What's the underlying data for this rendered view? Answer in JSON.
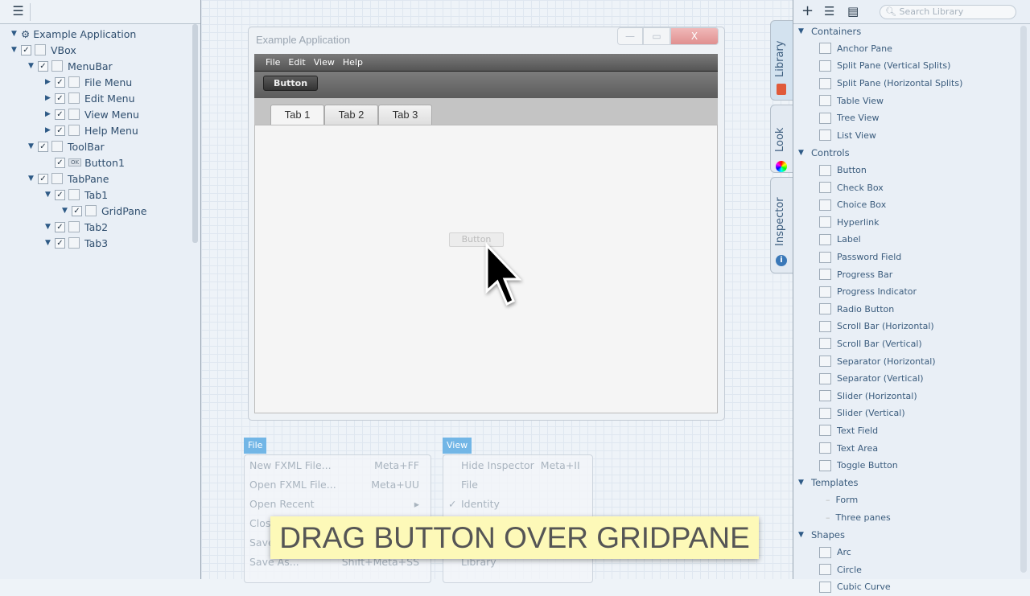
{
  "hierarchy": {
    "nodes": [
      {
        "label": "Example Application",
        "depth": 0,
        "check": false,
        "box": false,
        "expand": "down"
      },
      {
        "label": "VBox",
        "depth": 0,
        "check": true,
        "box": true,
        "expand": "down"
      },
      {
        "label": "MenuBar",
        "depth": 1,
        "check": true,
        "box": true,
        "expand": "down"
      },
      {
        "label": "File Menu",
        "depth": 2,
        "check": true,
        "box": true,
        "expand": "right"
      },
      {
        "label": "Edit Menu",
        "depth": 2,
        "check": true,
        "box": true,
        "expand": "right"
      },
      {
        "label": "View Menu",
        "depth": 2,
        "check": true,
        "box": true,
        "expand": "right"
      },
      {
        "label": "Help Menu",
        "depth": 2,
        "check": true,
        "box": true,
        "expand": "right"
      },
      {
        "label": "ToolBar",
        "depth": 1,
        "check": true,
        "box": true,
        "expand": "down"
      },
      {
        "label": "Button1",
        "depth": 2,
        "check": true,
        "box": false,
        "ok": "OK",
        "expand": ""
      },
      {
        "label": "TabPane",
        "depth": 1,
        "check": true,
        "box": true,
        "expand": "down"
      },
      {
        "label": "Tab1",
        "depth": 2,
        "check": true,
        "box": true,
        "expand": "down"
      },
      {
        "label": "GridPane",
        "depth": 3,
        "check": true,
        "box": true,
        "expand": "down"
      },
      {
        "label": "Tab2",
        "depth": 2,
        "check": true,
        "box": true,
        "expand": "down"
      },
      {
        "label": "Tab3",
        "depth": 2,
        "check": true,
        "box": true,
        "expand": "down"
      }
    ]
  },
  "app_window": {
    "title": "Example Application",
    "menus": [
      "File",
      "Edit",
      "View",
      "Help"
    ],
    "toolbar_button": "Button",
    "tabs": [
      "Tab 1",
      "Tab 2",
      "Tab 3"
    ],
    "dragged_button": "Button"
  },
  "file_menu": {
    "title": "File",
    "items": [
      [
        "New FXML File...",
        "Meta+FF"
      ],
      [
        "Open FXML File...",
        "Meta+UU"
      ],
      [
        "Open Recent",
        "▸"
      ],
      [
        "Clos",
        ""
      ],
      [
        "Save",
        ""
      ],
      [
        "Save As...",
        "Shift+Meta+SS"
      ]
    ]
  },
  "view_menu": {
    "title": "View",
    "items": [
      [
        "",
        "Hide Inspector",
        "Meta+II"
      ],
      [
        "",
        "File",
        ""
      ],
      [
        "✓",
        "Identity",
        ""
      ],
      [
        "",
        "",
        ""
      ],
      [
        "",
        "",
        ""
      ],
      [
        "",
        "Library",
        ""
      ]
    ]
  },
  "caption": "DRAG BUTTON OVER GRIDPANE",
  "side_tabs": [
    "Library",
    "Look",
    "Inspector"
  ],
  "library": {
    "search_placeholder": "Search Library",
    "rows": [
      {
        "t": "cat",
        "label": "Containers"
      },
      {
        "label": "Anchor Pane"
      },
      {
        "label": "Split Pane (Vertical Splits)"
      },
      {
        "label": "Split Pane (Horizontal Splits)"
      },
      {
        "label": "Table View"
      },
      {
        "label": "Tree View"
      },
      {
        "label": "List View"
      },
      {
        "t": "cat",
        "label": "Controls"
      },
      {
        "label": "Button"
      },
      {
        "label": "Check Box"
      },
      {
        "label": "Choice Box"
      },
      {
        "label": "Hyperlink"
      },
      {
        "label": "Label"
      },
      {
        "label": "Password Field"
      },
      {
        "label": "Progress Bar"
      },
      {
        "label": "Progress Indicator"
      },
      {
        "label": "Radio Button"
      },
      {
        "label": "Scroll Bar (Horizontal)"
      },
      {
        "label": "Scroll Bar (Vertical)"
      },
      {
        "label": "Separator (Horizontal)"
      },
      {
        "label": "Separator (Vertical)"
      },
      {
        "label": "Slider (Horizontal)"
      },
      {
        "label": "Slider (Vertical)"
      },
      {
        "label": "Text Field"
      },
      {
        "label": "Text Area"
      },
      {
        "label": "Toggle Button"
      },
      {
        "t": "cat",
        "label": "Templates"
      },
      {
        "label": "Form",
        "plain": true
      },
      {
        "label": "Three panes",
        "plain": true
      },
      {
        "t": "cat",
        "label": "Shapes"
      },
      {
        "label": "Arc"
      },
      {
        "label": "Circle"
      },
      {
        "label": "Cubic Curve"
      }
    ]
  }
}
